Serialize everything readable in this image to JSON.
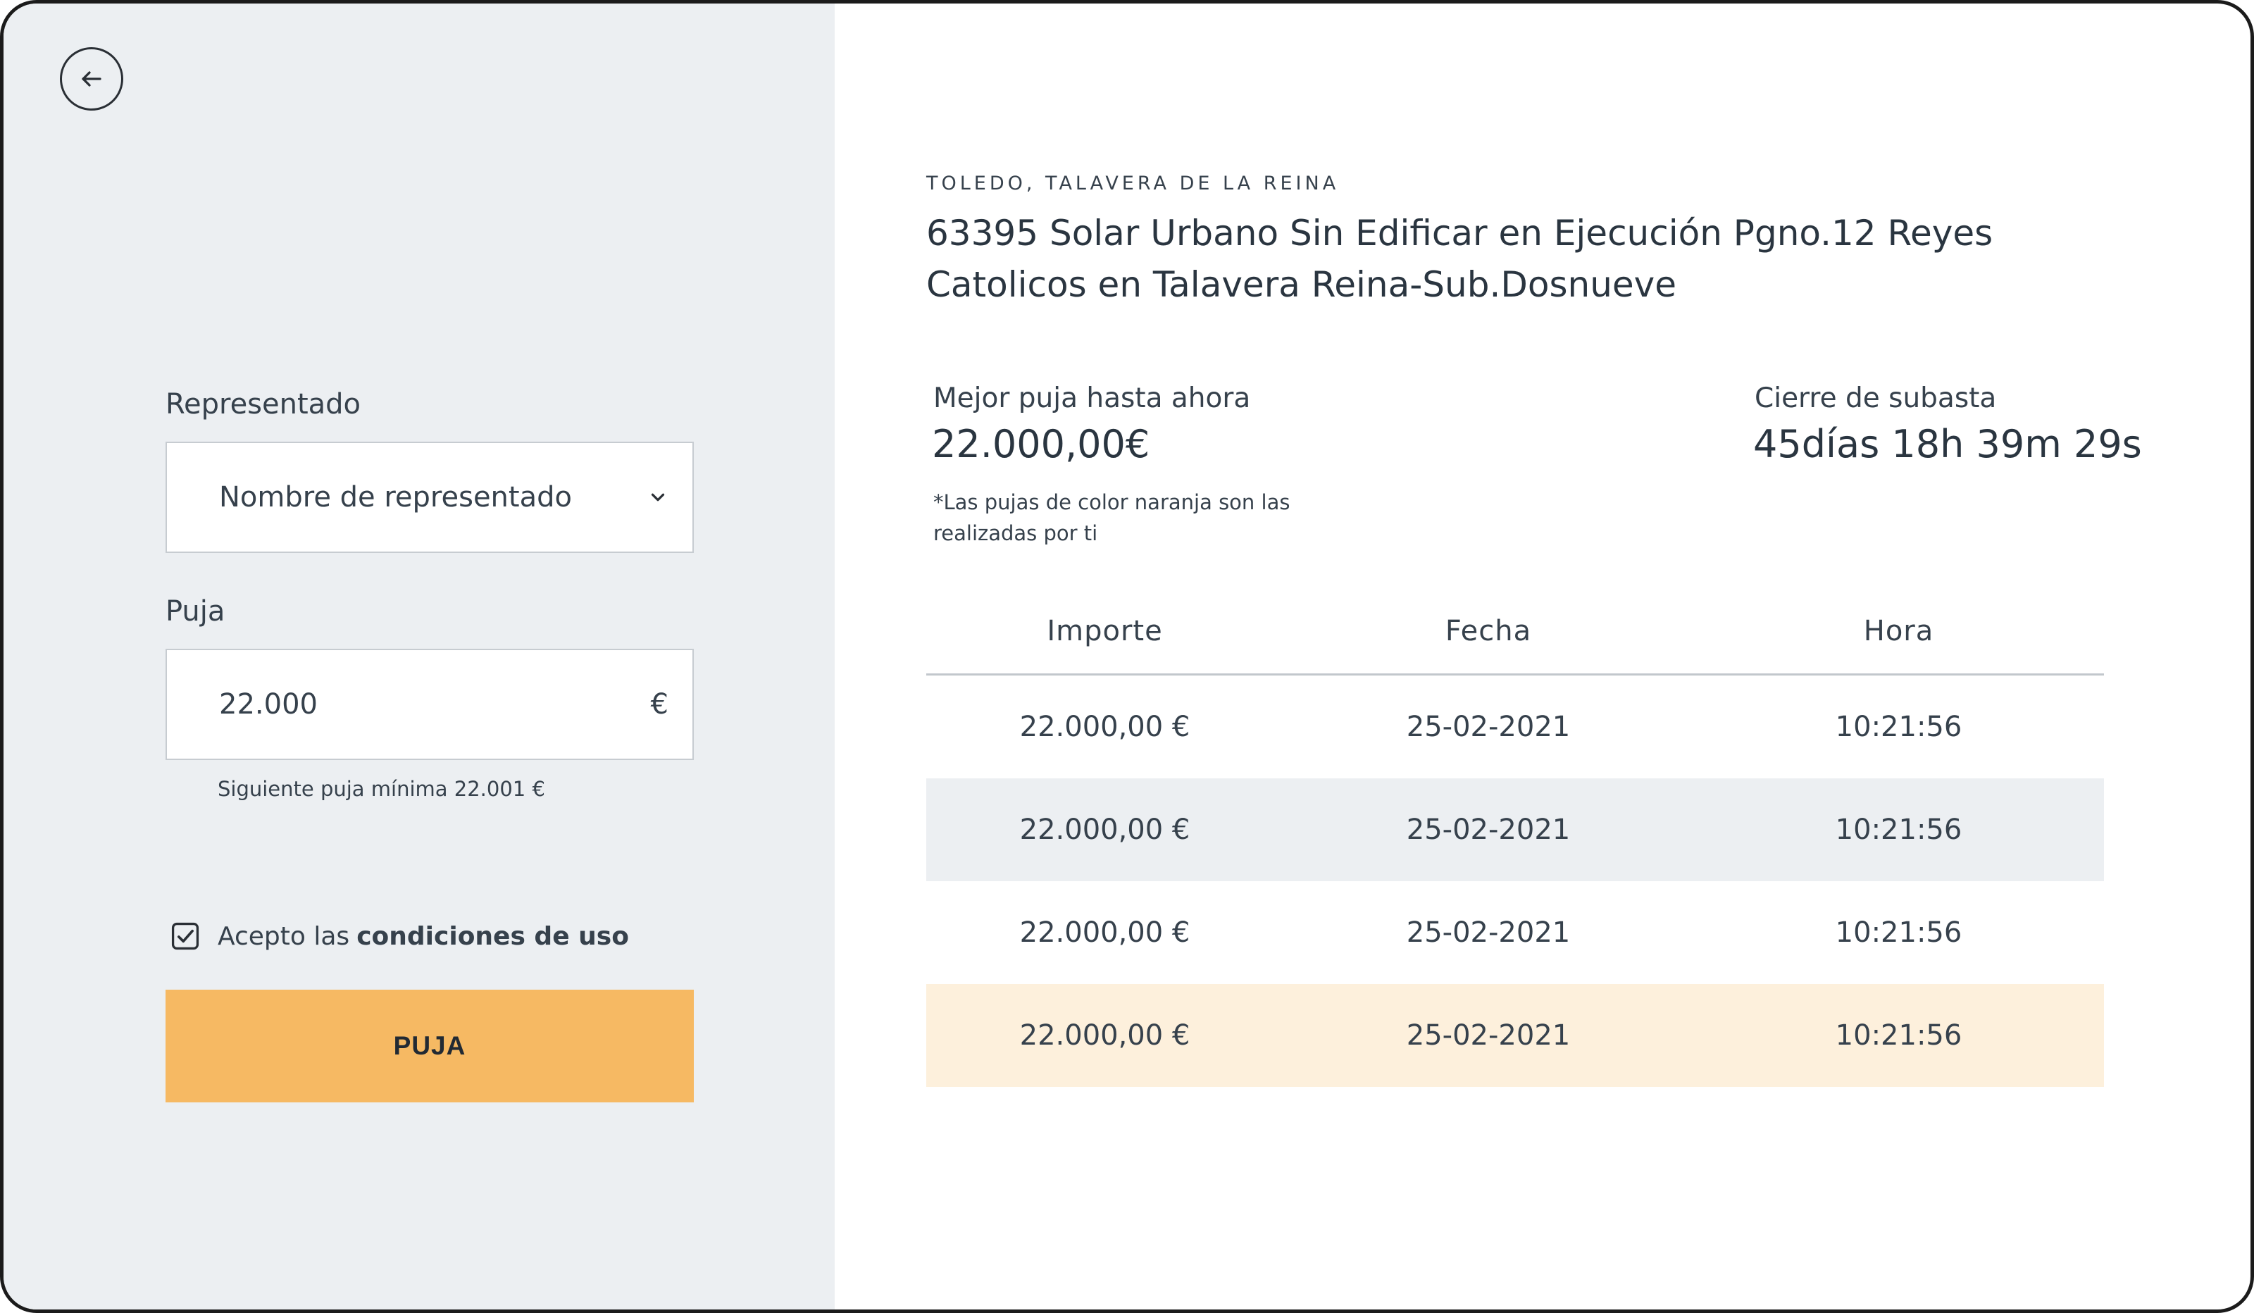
{
  "form": {
    "representado_label": "Representado",
    "representado_value": "Nombre de representado",
    "puja_label": "Puja",
    "puja_value": "22.000",
    "currency": "€",
    "hint": "Siguiente puja mínima 22.001 €",
    "terms_prefix": "Acepto las",
    "terms_link": "condiciones de uso",
    "terms_checked": true,
    "submit_label": "PUJA"
  },
  "auction": {
    "location": "TOLEDO, TALAVERA DE LA REINA",
    "title": "63395 Solar Urbano Sin Edificar en Ejecución Pgno.12 Reyes Catolicos en Talavera Reina-Sub.Dosnueve",
    "best_bid_label": "Mejor puja hasta ahora",
    "best_bid_value": "22.000,00€",
    "close_label": "Cierre de subasta",
    "close_value": "45días 18h 39m 29s",
    "note": "*Las pujas de color naranja son las realizadas por ti"
  },
  "table": {
    "headers": [
      "Importe",
      "Fecha",
      "Hora"
    ],
    "rows": [
      {
        "importe": "22.000,00 €",
        "fecha": "25-02-2021",
        "hora": "10:21:56",
        "style": "white"
      },
      {
        "importe": "22.000,00 €",
        "fecha": "25-02-2021",
        "hora": "10:21:56",
        "style": "gray"
      },
      {
        "importe": "22.000,00 €",
        "fecha": "25-02-2021",
        "hora": "10:21:56",
        "style": "white"
      },
      {
        "importe": "22.000,00 €",
        "fecha": "25-02-2021",
        "hora": "10:21:56",
        "style": "orange"
      }
    ]
  },
  "colors": {
    "left_panel_bg": "#eceff2",
    "accent_button": "#f6b963",
    "own_bid_row": "#fdf0dc",
    "alt_row": "#eceff2"
  },
  "icons": {
    "back": "arrow-left-icon",
    "select": "chevron-down-icon",
    "checkbox": "checkbox-checked-icon"
  }
}
